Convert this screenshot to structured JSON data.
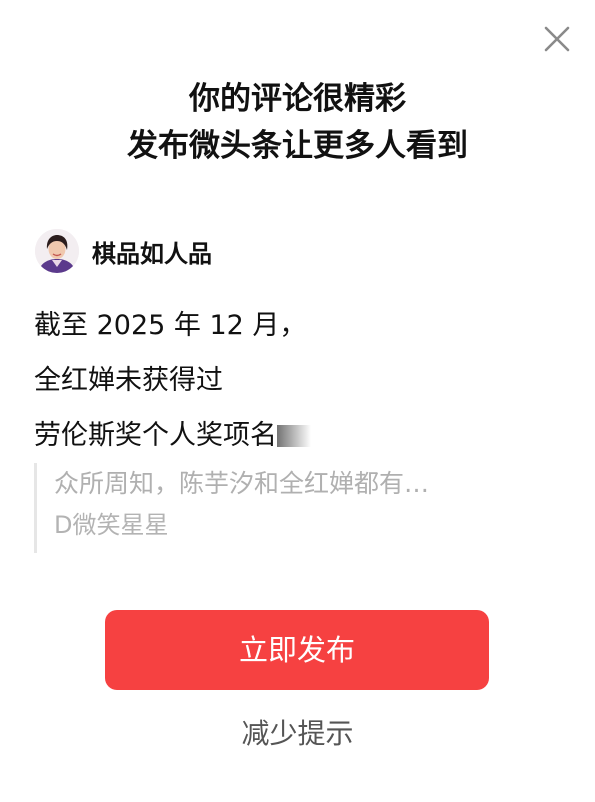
{
  "header": {
    "close_icon": "close-icon",
    "title_line1": "你的评论很精彩",
    "title_line2": "发布微头条让更多人看到"
  },
  "author": {
    "avatar_icon": "avatar",
    "name": "棋品如人品"
  },
  "comment": {
    "line1": "截至 2025 年 12 月，",
    "line2": "全红婵未获得过",
    "line3": "劳伦斯奖个人奖项名"
  },
  "quote": {
    "text": "众所周知，陈芋汐和全红婵都有…",
    "author": "D微笑星星"
  },
  "actions": {
    "publish_label": "立即发布",
    "reduce_label": "减少提示"
  },
  "colors": {
    "accent": "#f64141",
    "background": "#ffffff",
    "text_primary": "#111111",
    "text_muted": "#b0b0b0"
  }
}
